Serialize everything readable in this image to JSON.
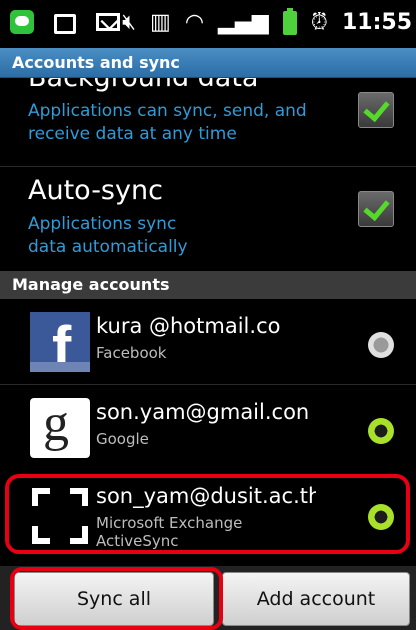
{
  "status_bar": {
    "time": "11:55",
    "left_icons": [
      "line-app-icon",
      "shopping-bag-icon",
      "mail-icon"
    ],
    "right_icons": [
      "mute-icon",
      "nfc-icon",
      "wifi-icon",
      "signal-icon",
      "battery-icon",
      "alarm-icon"
    ]
  },
  "header": {
    "title": "Accounts and sync"
  },
  "settings": {
    "background_data": {
      "title": "Background data",
      "description": "Applications can sync, send, and receive data at any time",
      "checked": true
    },
    "auto_sync": {
      "title": "Auto-sync",
      "description": "Applications sync data automatically",
      "checked": true
    }
  },
  "manage_accounts": {
    "header": "Manage accounts",
    "accounts": [
      {
        "email": "kura @hotmail.co",
        "type": "Facebook",
        "sync_status": "inactive",
        "icon": "facebook-icon"
      },
      {
        "email": "son.yam@gmail.con",
        "type": "Google",
        "sync_status": "active",
        "icon": "google-icon"
      },
      {
        "email": "son_yam@dusit.ac.th",
        "type": "Microsoft Exchange ActiveSync",
        "sync_status": "active",
        "icon": "exchange-icon"
      }
    ]
  },
  "buttons": {
    "sync_all": "Sync all",
    "add_account": "Add account"
  },
  "colors": {
    "accent_blue": "#2f9bd9",
    "title_bar": "#3a7fb8",
    "check_green": "#55d92a",
    "sync_green": "#a8e02a",
    "highlight_red": "#e60012"
  }
}
